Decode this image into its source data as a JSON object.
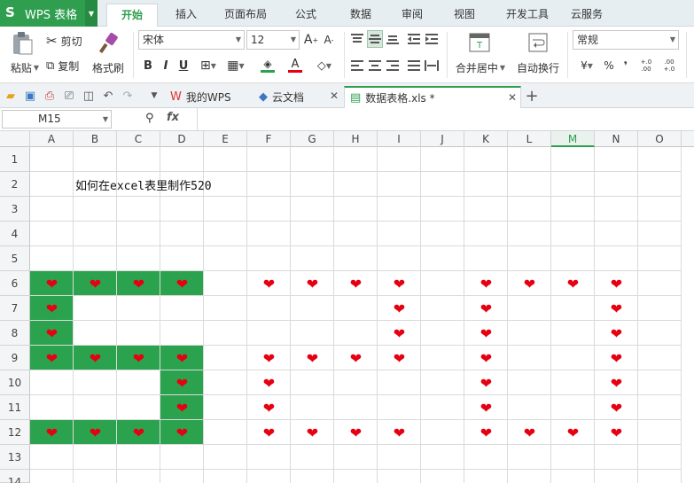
{
  "app": {
    "title": "WPS 表格"
  },
  "menu": {
    "tabs": [
      "开始",
      "插入",
      "页面布局",
      "公式",
      "数据",
      "审阅",
      "视图",
      "开发工具",
      "云服务"
    ],
    "active_index": 0
  },
  "ribbon": {
    "paste_label": "粘贴",
    "cut_label": "剪切",
    "copy_label": "复制",
    "format_painter_label": "格式刷",
    "font_name": "宋体",
    "font_size": "12",
    "merge_label": "合并居中",
    "wrap_label": "自动换行",
    "number_format": "常规",
    "bold": "B",
    "italic": "I",
    "underline": "U",
    "font_color_letter": "A",
    "percent": "%",
    "comma": "❜",
    "dec_increase": "+.0 .00",
    "dec_decrease": ".00 +.0"
  },
  "doc_tabs": [
    {
      "label": "我的WPS",
      "active": false
    },
    {
      "label": "云文档",
      "active": false
    },
    {
      "label": "数据表格.xls *",
      "active": true
    }
  ],
  "formula": {
    "cell_ref": "M15",
    "fx": "fx",
    "content": ""
  },
  "sheet": {
    "columns": [
      "A",
      "B",
      "C",
      "D",
      "E",
      "F",
      "G",
      "H",
      "I",
      "J",
      "K",
      "L",
      "M",
      "N",
      "O"
    ],
    "selected_column": "M",
    "rows": [
      "1",
      "2",
      "3",
      "4",
      "5",
      "6",
      "7",
      "8",
      "9",
      "10",
      "11",
      "12",
      "13",
      "14"
    ],
    "title_cell": {
      "ref": "B2",
      "text": "如何在excel表里制作520"
    },
    "heart_symbol": "❤",
    "heart_color": "#e60012",
    "fill_color": "#2ba34e",
    "green_cells": [
      "A6",
      "B6",
      "C6",
      "D6",
      "A7",
      "A8",
      "A9",
      "B9",
      "C9",
      "D9",
      "D10",
      "D11",
      "A12",
      "B12",
      "C12",
      "D12"
    ],
    "heart_cells": [
      "A6",
      "B6",
      "C6",
      "D6",
      "A7",
      "A8",
      "A9",
      "B9",
      "C9",
      "D9",
      "D10",
      "D11",
      "A12",
      "B12",
      "C12",
      "D12",
      "F6",
      "G6",
      "H6",
      "I6",
      "I7",
      "I8",
      "F9",
      "G9",
      "H9",
      "I9",
      "F10",
      "F11",
      "F12",
      "G12",
      "H12",
      "I12",
      "K6",
      "L6",
      "M6",
      "N6",
      "K7",
      "N7",
      "K8",
      "N8",
      "K9",
      "N9",
      "K10",
      "N10",
      "K11",
      "N11",
      "K12",
      "L12",
      "M12",
      "N12"
    ]
  },
  "colors": {
    "accent": "#2f9e4f",
    "menubar": "#e7eef2"
  }
}
